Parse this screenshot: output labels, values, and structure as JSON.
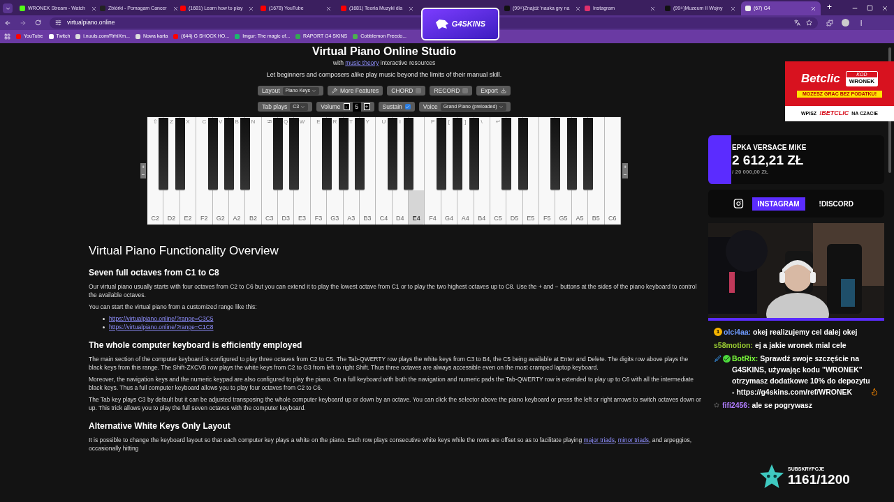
{
  "browser": {
    "tabs": [
      {
        "title": "WRONEK Stream - Watch",
        "color": "#53fc18",
        "selected": false
      },
      {
        "title": "Zbiórki - Pomagam Cancer",
        "color": "#222222",
        "selected": false
      },
      {
        "title": "(1681) Learn how to play",
        "color": "#ff0000",
        "selected": false
      },
      {
        "title": "(1678) YouTube",
        "color": "#ff0000",
        "selected": false
      },
      {
        "title": "(1681) Teoria Muzyki dla",
        "color": "#ff0000",
        "selected": false
      },
      {
        "title": "(99+)Znajdź 'nauka gry na",
        "color": "#111111",
        "selected": false
      },
      {
        "title": "Instagram",
        "color": "#e1306c",
        "selected": false
      },
      {
        "title": "(99+)Muzeum II Wojny",
        "color": "#111111",
        "selected": false
      },
      {
        "title": "(67) G4",
        "color": "#eeeeee",
        "selected": true
      }
    ],
    "new_tab": "+",
    "address": "virtualpiano.online",
    "bookmarks": [
      {
        "title": "YouTube",
        "color": "#ff0000"
      },
      {
        "title": "Twitch",
        "color": "#ffffff"
      },
      {
        "title": "i.nuuls.com/RrhiXm...",
        "color": "#dddddd"
      },
      {
        "title": "Nowa karta",
        "color": "#dddddd"
      },
      {
        "title": "(644) G SHOCK HO...",
        "color": "#ff0000"
      },
      {
        "title": "Imgur: The magic of...",
        "color": "#1bb76e"
      },
      {
        "title": "RAPORT G4 SKINS",
        "color": "#34a853"
      },
      {
        "title": "Cobblemon Freedo...",
        "color": "#4caf50"
      }
    ]
  },
  "stream_logo": "G4SKINS",
  "piano_page": {
    "title": "Virtual Piano Online Studio",
    "subtitle_before": "with",
    "subtitle_link": "music theory",
    "subtitle_after": "interactive resources",
    "tagline": "Let beginners and composers alike play music beyond the limits of their manual skill.",
    "control_rows": [
      [
        {
          "kind": "select",
          "label": "Layout",
          "value": "Piano Keys"
        },
        {
          "kind": "tool",
          "label": "More Features"
        },
        {
          "kind": "toggle",
          "label": "CHORD",
          "checked": false
        },
        {
          "kind": "toggle",
          "label": "RECORD",
          "checked": false
        },
        {
          "kind": "export",
          "label": "Export"
        }
      ],
      [
        {
          "kind": "select",
          "label": "Tab plays",
          "value": "C3"
        },
        {
          "kind": "stepper",
          "label": "Volume",
          "value": "5",
          "minus": "-",
          "plus": "+"
        },
        {
          "kind": "toggle",
          "label": "Sustain",
          "checked": true
        },
        {
          "kind": "select",
          "label": "Voice",
          "value": "Grand Piano (preloaded)"
        }
      ]
    ],
    "octave_plus": "+",
    "octave_minus": "−",
    "keys": [
      {
        "note": "C2",
        "key": "⇧",
        "pressed": false
      },
      {
        "note": "D2",
        "key": "Z",
        "pressed": false
      },
      {
        "note": "E2",
        "key": "X",
        "pressed": false
      },
      {
        "note": "F2",
        "key": "C",
        "pressed": false
      },
      {
        "note": "G2",
        "key": "V",
        "pressed": false
      },
      {
        "note": "A2",
        "key": "B",
        "pressed": false
      },
      {
        "note": "B2",
        "key": "N",
        "pressed": false
      },
      {
        "note": "C3",
        "key": "⭾",
        "pressed": false
      },
      {
        "note": "D3",
        "key": "Q",
        "pressed": false
      },
      {
        "note": "E3",
        "key": "W",
        "pressed": false
      },
      {
        "note": "F3",
        "key": "E",
        "pressed": false
      },
      {
        "note": "G3",
        "key": "R",
        "pressed": false
      },
      {
        "note": "A3",
        "key": "T",
        "pressed": false
      },
      {
        "note": "B3",
        "key": "Y",
        "pressed": false
      },
      {
        "note": "C4",
        "key": "U",
        "pressed": false
      },
      {
        "note": "D4",
        "key": "I",
        "pressed": false
      },
      {
        "note": "E4",
        "pressed": true
      },
      {
        "note": "F4",
        "key": "P",
        "pressed": false
      },
      {
        "note": "G4",
        "key": "[",
        "pressed": false
      },
      {
        "note": "A4",
        "key": "]",
        "pressed": false
      },
      {
        "note": "B4",
        "key": "\\",
        "pressed": false
      },
      {
        "note": "C5",
        "key": "↵",
        "pressed": false
      },
      {
        "note": "D5",
        "pressed": false
      },
      {
        "note": "E5",
        "pressed": false
      },
      {
        "note": "F5",
        "pressed": false
      },
      {
        "note": "G5",
        "pressed": false
      },
      {
        "note": "A5",
        "pressed": false
      },
      {
        "note": "B5",
        "pressed": false
      },
      {
        "note": "C6",
        "pressed": false
      }
    ]
  },
  "article": {
    "heading": "Virtual Piano Functionality Overview",
    "blocks": [
      {
        "kind": "h3",
        "text": "Seven full octaves from C1 to C8"
      },
      {
        "kind": "p",
        "segments": [
          {
            "text": "Our virtual piano usually starts with four octaves from C2 to C6 but you can extend it to play the lowest octave from C1 or to play the two highest octaves up to C8. Use the + and − buttons at the sides of the piano keyboard to control the available octaves.",
            "link": false
          }
        ]
      },
      {
        "kind": "p",
        "segments": [
          {
            "text": "You can start the virtual piano from a customized range like this:",
            "link": false
          }
        ]
      },
      {
        "kind": "links",
        "items": [
          "https://virtualpiano.online/?range=C3C5",
          "https://virtualpiano.online/?range=C1C8"
        ]
      },
      {
        "kind": "h3",
        "text": "The whole computer keyboard is efficiently employed"
      },
      {
        "kind": "p",
        "segments": [
          {
            "text": "The main section of the computer keyboard is configured to play three octaves from C2 to C5. The Tab-QWERTY row plays the white keys from C3 to B4, the C5 being available at Enter and Delete. The digits row above plays the black keys from this range. The Shift-ZXCVB row plays the white keys from C2 to G3 from left to right Shift. Thus three octaves are always accessible even on the most cramped laptop keyboard.",
            "link": false
          }
        ]
      },
      {
        "kind": "p",
        "segments": [
          {
            "text": "Moreover, the navigation keys and the numeric keypad are also configured to play the piano. On a full keyboard with both the navigation and numeric pads the Tab-QWERTY row is extended to play up to C6 with all the intermediate black keys. Thus a full computer keyboard allows you to play four octaves from C2 to C6.",
            "link": false
          }
        ]
      },
      {
        "kind": "p",
        "segments": [
          {
            "text": "The Tab key plays C3 by default but it can be adjusted transposing the whole computer keyboard up or down by an octave. You can click the selector above the piano keyboard or press the left or right arrows to switch octaves down or up. This trick allows you to play the full seven octaves with the computer keyboard.",
            "link": false
          }
        ]
      },
      {
        "kind": "h3",
        "text": "Alternative White Keys Only Layout"
      },
      {
        "kind": "p",
        "segments": [
          {
            "text": "It is possible to change the keyboard layout so that each computer key plays a white on the piano. Each row plays consecutive white keys while the rows are offset so as to facilitate playing",
            "link": false
          },
          {
            "text": "major triads",
            "link": true
          },
          {
            "text": ",",
            "link": false
          },
          {
            "text": "minor triads",
            "link": true
          },
          {
            "text": ", and arpeggios, occasionally hitting",
            "link": false
          }
        ]
      }
    ]
  },
  "overlay": {
    "ad": {
      "brand": "Betclic",
      "code_label": "KOD",
      "code": "WRONEK",
      "slogan": "MOZESZ GRAC BEZ PODATKU!",
      "cta_before": "WPISZ",
      "cta_command": "!BETCLIC",
      "cta_after": "NA CZACIE"
    },
    "goal": {
      "name": "EPKA VERSACE MIKE",
      "amount": "2 612,21 ZŁ",
      "target": "/ 20 000,00 ZŁ",
      "level": 0.13
    },
    "socials": [
      {
        "label": "INSTAGRAM",
        "selected": true
      },
      {
        "label": "!DISCORD",
        "selected": false
      }
    ],
    "chat": [
      {
        "kind": "badge",
        "badge": "1",
        "user": "olci4aa:",
        "color": "#6f9bff",
        "text": "okej realizujemy cel dalej okej"
      },
      {
        "kind": "plain",
        "user": "s58motion:",
        "color": "#9acd32",
        "text": "ej a jakie wronek mial cele"
      },
      {
        "kind": "bot",
        "user": "BotRix:",
        "color": "#7cfc3c",
        "text": "Sprawdź swoje szczęście na G4SKINS, używając kodu \"WRONEK\" otrzymasz dodatkowe 10% do depozytu - https://g4skins.com/ref/WRONEK"
      },
      {
        "kind": "sub",
        "user": "fifi2456:",
        "color": "#b17dff",
        "text": "ale se pogrywasz"
      }
    ],
    "subs": {
      "label": "SUBSKRYPCJE",
      "count": "1161/1200"
    }
  }
}
